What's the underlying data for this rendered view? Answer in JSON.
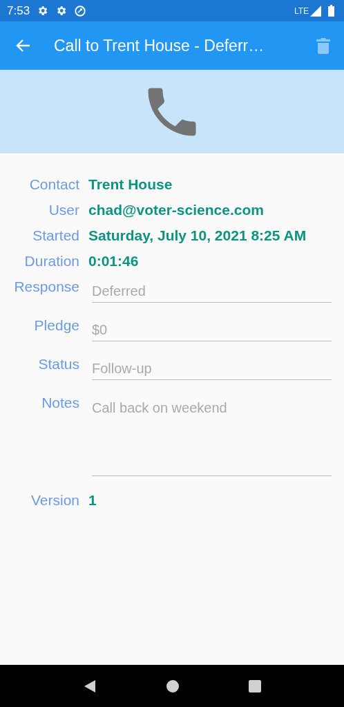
{
  "status_bar": {
    "time": "7:53",
    "network": "LTE"
  },
  "app_bar": {
    "title": "Call to Trent House - Deferr…"
  },
  "details": [
    {
      "label": "Contact",
      "value": "Trent House"
    },
    {
      "label": "User",
      "value": "chad@voter-science.com"
    },
    {
      "label": "Started",
      "value": "Saturday, July 10, 2021 8:25 AM"
    },
    {
      "label": "Duration",
      "value": "0:01:46"
    }
  ],
  "fields": [
    {
      "label": "Response",
      "value": "Deferred",
      "kind": "line"
    },
    {
      "label": "Pledge",
      "value": "$0",
      "kind": "line"
    },
    {
      "label": "Status",
      "value": "Follow-up",
      "kind": "line"
    },
    {
      "label": "Notes",
      "value": "Call back on weekend",
      "kind": "multiline"
    }
  ],
  "version": {
    "label": "Version",
    "value": "1"
  }
}
